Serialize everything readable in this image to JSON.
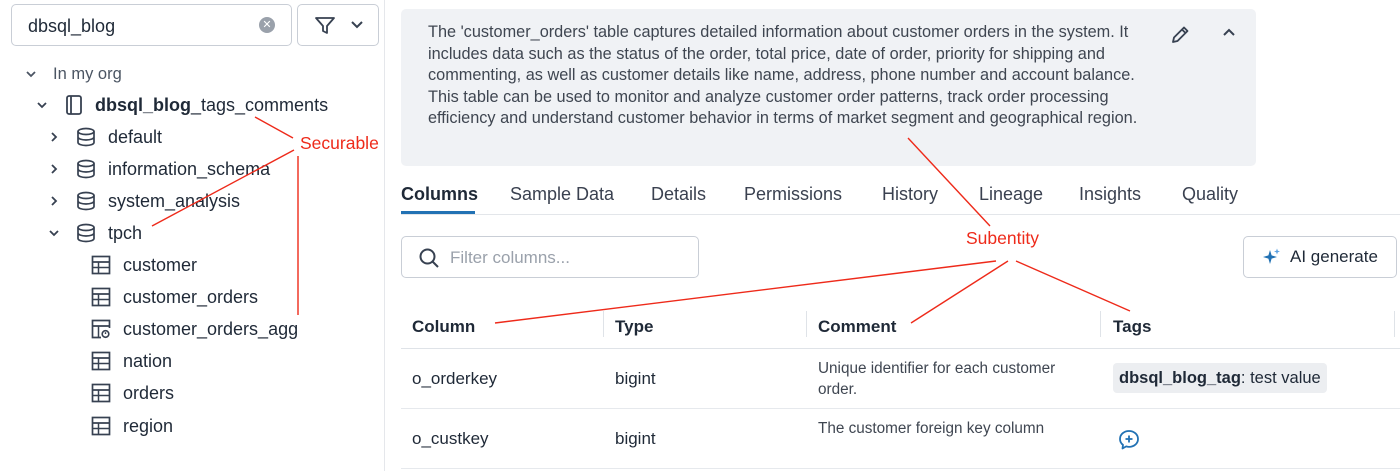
{
  "search": {
    "value": "dbsql_blog"
  },
  "tree": {
    "group_label": "In my org",
    "catalog": {
      "bold": "dbsql_blog",
      "rest": "_tags_comments"
    },
    "schemas": [
      "default",
      "information_schema",
      "system_analysis",
      "tpch"
    ],
    "tables": [
      "customer",
      "customer_orders",
      "customer_orders_agg",
      "nation",
      "orders",
      "region"
    ]
  },
  "description": "The 'customer_orders' table captures detailed information about customer orders in the system. It includes data such as the status of the order, total price, date of order, priority for shipping and commenting, as well as customer details like name, address, phone number and account balance. This table can be used to monitor and analyze customer order patterns, track order processing efficiency and understand customer behavior in terms of market segment and geographical region.",
  "tabs": [
    "Columns",
    "Sample Data",
    "Details",
    "Permissions",
    "History",
    "Lineage",
    "Insights",
    "Quality"
  ],
  "filter_columns": {
    "placeholder": "Filter columns..."
  },
  "ai_button": "AI generate",
  "table": {
    "headers": [
      "Column",
      "Type",
      "Comment",
      "Tags"
    ],
    "rows": [
      {
        "column": "o_orderkey",
        "type": "bigint",
        "comment": "Unique identifier for each customer order.",
        "tag_key": "dbsql_blog_tag",
        "tag_value": ": test value"
      },
      {
        "column": "o_custkey",
        "type": "bigint",
        "comment": "The customer foreign key column"
      }
    ]
  },
  "annotations": {
    "securable": "Securable",
    "subentity": "Subentity",
    "color": "#ee2a1a"
  },
  "colors": {
    "accent": "#2272b4",
    "annotation": "#ee2a1a"
  }
}
